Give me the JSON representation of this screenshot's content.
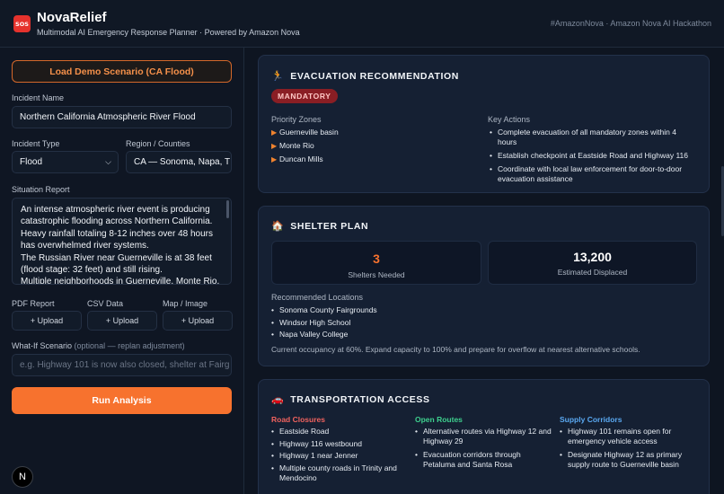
{
  "header": {
    "logo_text": "SOS",
    "title": "NovaRelief",
    "subtitle": "Multimodal AI Emergency Response Planner · Powered by Amazon Nova",
    "right_text": "#AmazonNova · Amazon Nova AI Hackathon"
  },
  "left": {
    "demo_button": "Load Demo Scenario (CA Flood)",
    "incident_name_label": "Incident Name",
    "incident_name_value": "Northern California Atmospheric River Flood",
    "incident_type_label": "Incident Type",
    "incident_type_value": "Flood",
    "region_label": "Region / Counties",
    "region_value": "CA — Sonoma, Napa, T",
    "situation_label": "Situation Report",
    "situation_lines": [
      "An intense atmospheric river event is producing catastrophic flooding across Northern California. Heavy rainfall totaling 8-12 inches over 48 hours has overwhelmed river systems.",
      "The Russian River near Guerneville is at 38 feet (flood stage: 32 feet) and still rising.",
      "Multiple neighborhoods in Guerneville, Monte Rio,"
    ],
    "uploads": [
      {
        "label": "PDF Report",
        "button": "+ Upload"
      },
      {
        "label": "CSV Data",
        "button": "+ Upload"
      },
      {
        "label": "Map / Image",
        "button": "+ Upload"
      }
    ],
    "whatif_label": "What-If Scenario",
    "whatif_optional": "(optional — replan adjustment)",
    "whatif_placeholder": "e.g. Highway 101 is now also closed, shelter at Fairg",
    "run_button": "Run Analysis",
    "avatar_letter": "N"
  },
  "evacuation": {
    "title": "EVACUATION RECOMMENDATION",
    "badge": "MANDATORY",
    "zones_label": "Priority Zones",
    "zones": [
      "Guerneville basin",
      "Monte Rio",
      "Duncan Mills"
    ],
    "actions_label": "Key Actions",
    "actions": [
      "Complete evacuation of all mandatory zones within 4 hours",
      "Establish checkpoint at Eastside Road and Highway 116",
      "Coordinate with local law enforcement for door-to-door evacuation assistance"
    ]
  },
  "shelter": {
    "title": "SHELTER PLAN",
    "shelters_needed": "3",
    "shelters_caption": "Shelters Needed",
    "displaced": "13,200",
    "displaced_caption": "Estimated Displaced",
    "locations_label": "Recommended Locations",
    "locations": [
      "Sonoma County Fairgrounds",
      "Windsor High School",
      "Napa Valley College"
    ],
    "note": "Current occupancy at 60%. Expand capacity to 100% and prepare for overflow at nearest alternative schools."
  },
  "transport": {
    "title": "TRANSPORTATION ACCESS",
    "closures_label": "Road Closures",
    "closures": [
      "Eastside Road",
      "Highway 116 westbound",
      "Highway 1 near Jenner",
      "Multiple county roads in Trinity and Mendocino"
    ],
    "open_label": "Open Routes",
    "open": [
      "Alternative routes via Highway 12 and Highway 29",
      "Evacuation corridors through Petaluma and Santa Rosa"
    ],
    "supply_label": "Supply Corridors",
    "supply": [
      "Highway 101 remains open for emergency vehicle access",
      "Designate Highway 12 as primary supply route to Guerneville basin"
    ]
  },
  "colors": {
    "accent_orange": "#f7722e",
    "danger_red": "#e5322d",
    "closures_red": "#f0625e",
    "open_green": "#3ecf8e",
    "supply_blue": "#5aa9f2"
  },
  "icons": {
    "evacuation": "running-person-icon",
    "shelter": "house-icon",
    "transport": "car-icon",
    "select": "chevron-down-icon"
  }
}
